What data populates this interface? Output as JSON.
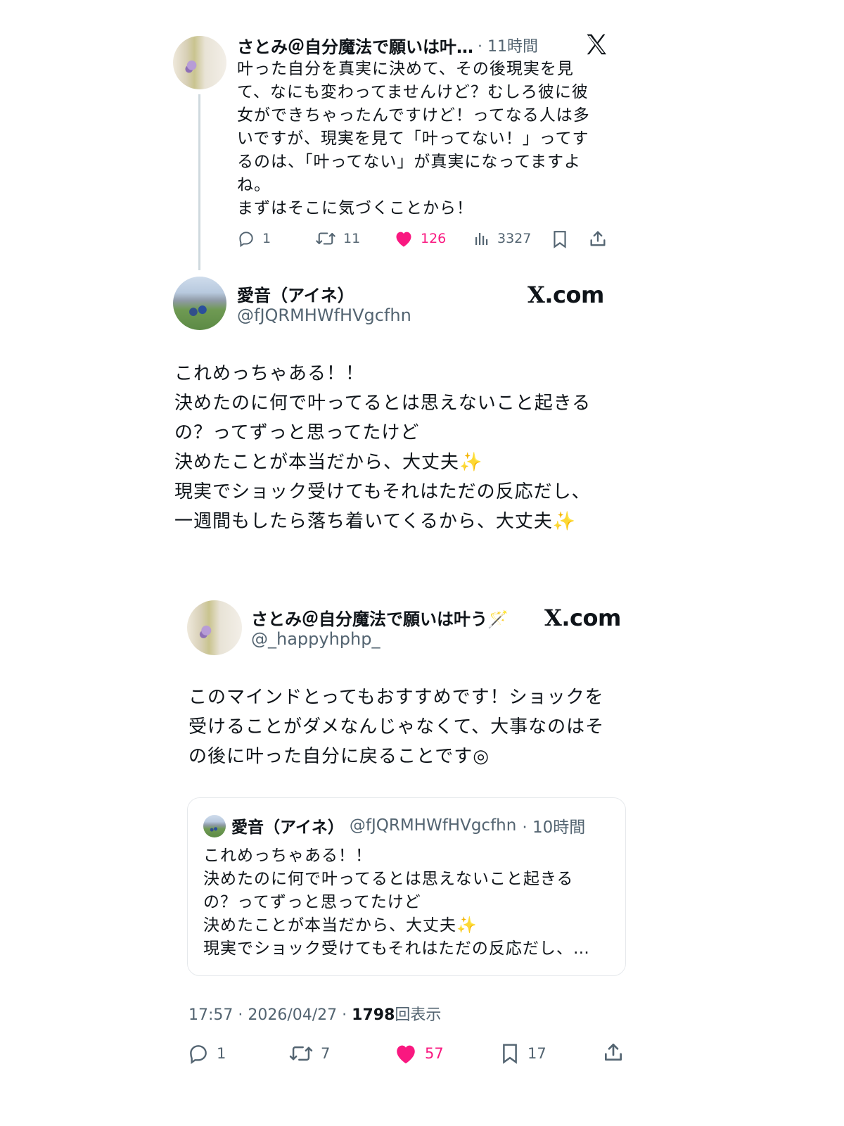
{
  "post1": {
    "display_name": "さとみ＠自分魔法で願いは叶…",
    "time": "· 11時間",
    "text": "叶った自分を真実に決めて、その後現実を見\nて、なにも変わってませんけど？むしろ彼に彼\n女ができちゃったんですけど！ってなる人は多\nいですが、現実を見て「叶ってない！」ってす\nるのは、「叶ってない」が真実になってますよ\nね。\nまずはそこに気づくことから！",
    "replies": "1",
    "reposts": "11",
    "likes": "126",
    "views": "3327"
  },
  "post2": {
    "display_name": "愛音（アイネ）",
    "handle": "@fJQRMHWfHVgcfhn",
    "xcom": ".com",
    "xcom_mark": "X",
    "text": "これめっちゃある！！\n決めたのに何で叶ってるとは思えないこと起きる\nの？ってずっと思ってたけど\n決めたことが本当だから、大丈夫✨\n現実でショック受けてもそれはただの反応だし、\n一週間もしたら落ち着いてくるから、大丈夫✨"
  },
  "post3": {
    "display_name": "さとみ＠自分魔法で願いは叶う🪄",
    "handle": "@_happyhphp_",
    "xcom": ".com",
    "xcom_mark": "X",
    "text": "このマインドとってもおすすめです！ショックを\n受けることがダメなんじゃなくて、大事なのはそ\nの後に叶った自分に戻ることです◎",
    "quote": {
      "display_name": "愛音（アイネ）",
      "handle": "@fJQRMHWfHVgcfhn",
      "time": "· 10時間",
      "text": "これめっちゃある！！\n決めたのに何で叶ってるとは思えないこと起きる\nの？ってずっと思ってたけど\n決めたことが本当だから、大丈夫✨\n現実でショック受けてもそれはただの反応だし、…"
    },
    "timestamp": "17:57 · 2026/04/27 · ",
    "view_count": "1798",
    "view_label": "回表示",
    "replies": "1",
    "reposts": "7",
    "likes": "57",
    "bookmarks": "17"
  },
  "colors": {
    "like": "#f91880",
    "muted": "#536471",
    "border": "#e6e9ec"
  }
}
